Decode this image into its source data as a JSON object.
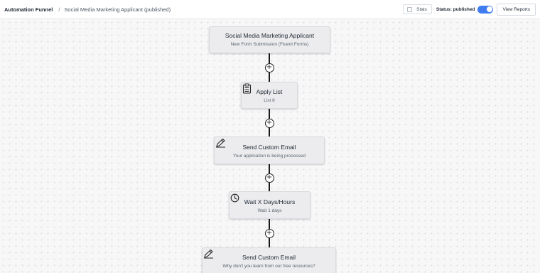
{
  "header": {
    "title": "Automation Funnel",
    "separator": "/",
    "subtitle": "Social Media Marketing Applicant (published)",
    "stats_label": "Stats",
    "status_label": "Status: published",
    "status_on": true,
    "view_reports_label": "View Reports"
  },
  "funnel": {
    "trigger": {
      "title": "Social Media Marketing Applicant",
      "subtitle": "New Form Submission (Fluent Forms)"
    },
    "steps": [
      {
        "title": "Apply List",
        "subtitle": "List 8",
        "icon": "clipboard-list-icon"
      },
      {
        "title": "Send Custom Email",
        "subtitle": "Your application is being processed",
        "icon": "pen-email-icon"
      },
      {
        "title": "Wait X Days/Hours",
        "subtitle": "Wait 1 days",
        "icon": "clock-icon"
      },
      {
        "title": "Send Custom Email",
        "subtitle": "Why don't you learn from our free resources?",
        "icon": "pen-email-icon"
      }
    ],
    "add_button_symbol": "+"
  },
  "colors": {
    "accent": "#3e7cf0",
    "node_bg": "#ececee",
    "connector": "#1a1a1a"
  }
}
